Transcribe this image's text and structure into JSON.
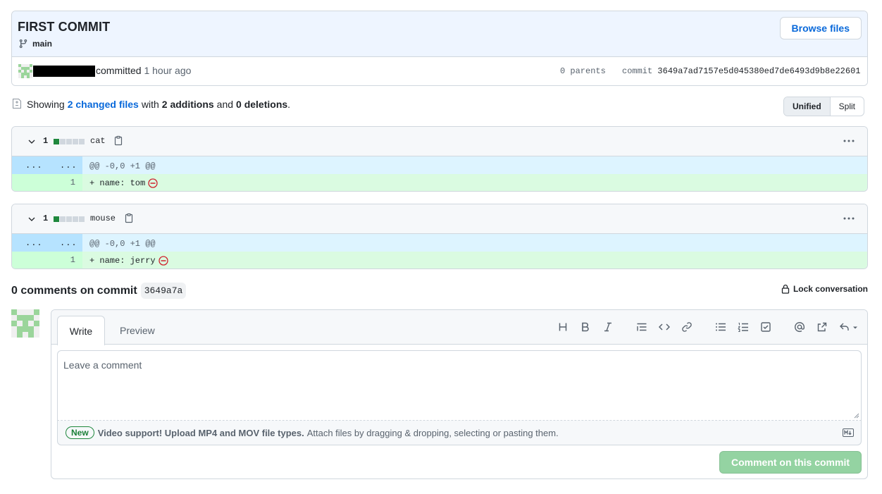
{
  "commit": {
    "title": "FIRST COMMIT",
    "branch": "main",
    "browse_label": "Browse files",
    "committed_text": "committed",
    "time_ago": "1 hour ago",
    "parents": "0 parents",
    "commit_label": "commit",
    "sha": "3649a7ad7157e5d045380ed7de6493d9b8e22601"
  },
  "summary": {
    "showing": "Showing",
    "changed_files": "2 changed files",
    "with": "with",
    "additions": "2 additions",
    "and": "and",
    "deletions": "0 deletions",
    "period": "."
  },
  "view_toggle": {
    "unified": "Unified",
    "split": "Split"
  },
  "files": [
    {
      "count": "1",
      "name": "cat",
      "hunk_dots": "...",
      "hunk": "@@ -0,0 +1 @@",
      "line_no": "1",
      "code": "+ name: tom"
    },
    {
      "count": "1",
      "name": "mouse",
      "hunk_dots": "...",
      "hunk": "@@ -0,0 +1 @@",
      "line_no": "1",
      "code": "+ name: jerry"
    }
  ],
  "comments": {
    "title": "0 comments on commit",
    "short_sha": "3649a7a",
    "lock_label": "Lock conversation"
  },
  "form": {
    "tab_write": "Write",
    "tab_preview": "Preview",
    "placeholder": "Leave a comment",
    "new_badge": "New",
    "video_bold": "Video support! Upload MP4 and MOV file types.",
    "attach_text": "Attach files by dragging & dropping, selecting or pasting them.",
    "submit_label": "Comment on this commit",
    "toolbar_icons": [
      "heading-icon",
      "bold-icon",
      "italic-icon",
      "quote-icon",
      "code-icon",
      "link-icon",
      "bulleted-list-icon",
      "numbered-list-icon",
      "tasklist-icon",
      "mention-icon",
      "cross-reference-icon",
      "reply-icon"
    ]
  },
  "colors": {
    "accent_blue": "#0969da",
    "add_green": "#1f883d",
    "header_bg": "#eef5ff",
    "submit_disabled": "#94d3a2"
  }
}
